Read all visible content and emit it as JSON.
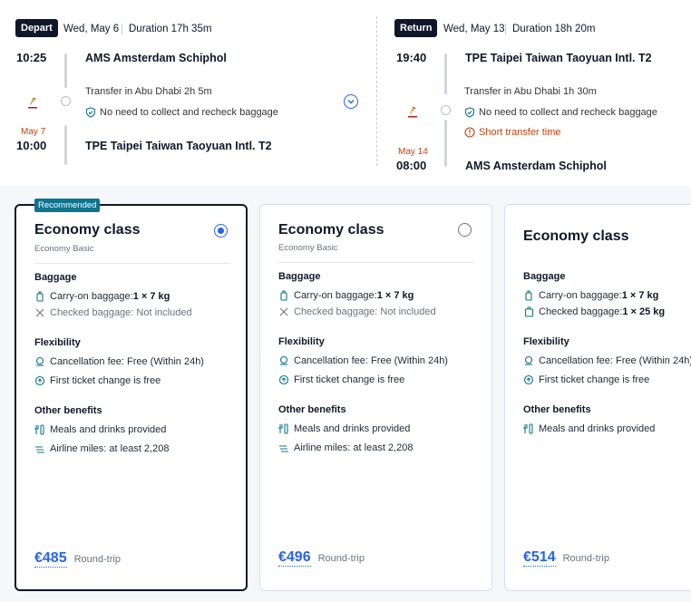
{
  "outbound": {
    "label": "Depart",
    "date": "Wed, May 6",
    "duration": "Duration 17h 35m",
    "dep_time": "10:25",
    "dep_airport": "AMS Amsterdam Schiphol",
    "transfer": "Transfer in Abu Dhabi  2h 5m",
    "baggage_note": "No need to collect and recheck baggage",
    "arr_date": "May 7",
    "arr_time": "10:00",
    "arr_airport": "TPE Taipei Taiwan Taoyuan Intl. T2"
  },
  "return": {
    "label": "Return",
    "date": "Wed, May 13",
    "duration": "Duration 18h 20m",
    "dep_time": "19:40",
    "dep_airport": "TPE Taipei Taiwan Taoyuan Intl. T2",
    "transfer": "Transfer in Abu Dhabi  1h 30m",
    "baggage_note": "No need to collect and recheck baggage",
    "warning": "Short transfer time",
    "arr_date": "May 14",
    "arr_time": "08:00",
    "arr_airport": "AMS Amsterdam Schiphol"
  },
  "section_labels": {
    "baggage": "Baggage",
    "flexibility": "Flexibility",
    "other": "Other benefits",
    "round_trip": "Round-trip"
  },
  "cards": [
    {
      "badge": "Recommended",
      "title": "Economy class",
      "subtitle": "Economy Basic",
      "selected": true,
      "carry_on_label": "Carry-on baggage: ",
      "carry_on_value": "1 × 7 kg",
      "checked_label": "Checked baggage: Not included",
      "cancel": "Cancellation fee: Free (Within 24h)",
      "change": "First ticket change is free",
      "meals": "Meals and drinks provided",
      "miles": "Airline miles: at least 2,208",
      "price": "€485"
    },
    {
      "title": "Economy class",
      "subtitle": "Economy Basic",
      "selected": false,
      "carry_on_label": "Carry-on baggage: ",
      "carry_on_value": "1 × 7 kg",
      "checked_label": "Checked baggage: Not included",
      "cancel": "Cancellation fee: Free (Within 24h)",
      "change": "First ticket change is free",
      "meals": "Meals and drinks provided",
      "miles": "Airline miles: at least 2,208",
      "price": "€496"
    },
    {
      "title": "Economy class",
      "carry_on_label": "Carry-on baggage: ",
      "carry_on_value": "1 × 7 kg",
      "checked_label": "Checked baggage: ",
      "checked_value": "1 × 25 kg",
      "cancel": "Cancellation fee: Free (Within 24h)",
      "change": "First ticket change is free",
      "meals": "Meals and drinks provided",
      "price": "€514"
    }
  ],
  "colors": {
    "accent": "#2563eb",
    "badge": "#0e7490",
    "warning": "#c2410c",
    "dark": "#0f1729"
  }
}
